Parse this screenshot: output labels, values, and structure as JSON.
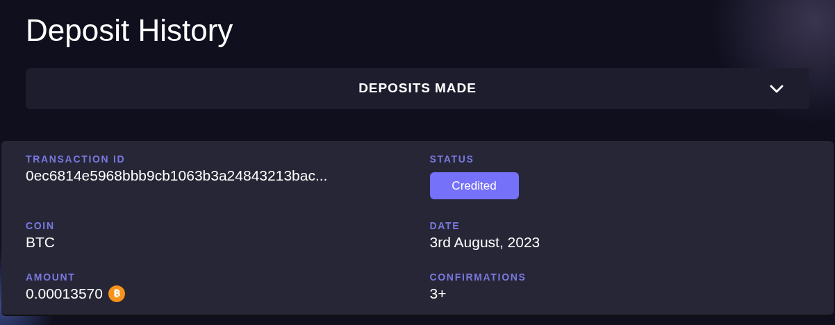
{
  "title": "Deposit History",
  "dropdown": {
    "label": "DEPOSITS MADE",
    "expanded": false
  },
  "fields": [
    {
      "label": "TRANSACTION ID",
      "kind": "text",
      "value": "0ec6814e5968bbb9cb1063b3a24843213bac..."
    },
    {
      "label": "STATUS",
      "kind": "badge",
      "value": "Credited"
    },
    {
      "label": "COIN",
      "kind": "text",
      "value": "BTC"
    },
    {
      "label": "DATE",
      "kind": "text",
      "value": "3rd August, 2023"
    },
    {
      "label": "AMOUNT",
      "kind": "amount",
      "value": "0.00013570"
    },
    {
      "label": "CONFIRMATIONS",
      "kind": "text",
      "value": "3+"
    }
  ]
}
